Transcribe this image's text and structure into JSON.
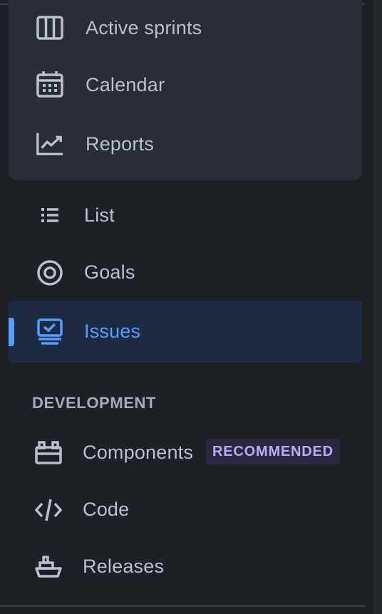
{
  "nav": {
    "planning_items": [
      {
        "label": "Active sprints",
        "icon": "board-columns-icon"
      },
      {
        "label": "Calendar",
        "icon": "calendar-icon"
      },
      {
        "label": "Reports",
        "icon": "chart-line-icon"
      }
    ],
    "items": [
      {
        "label": "List",
        "icon": "list-icon"
      },
      {
        "label": "Goals",
        "icon": "target-icon"
      },
      {
        "label": "Issues",
        "icon": "issues-icon",
        "selected": true
      }
    ]
  },
  "development": {
    "heading": "DEVELOPMENT",
    "items": [
      {
        "label": "Components",
        "icon": "components-icon",
        "badge": "RECOMMENDED"
      },
      {
        "label": "Code",
        "icon": "code-icon"
      },
      {
        "label": "Releases",
        "icon": "ship-icon"
      }
    ]
  },
  "colors": {
    "background": "#1d2125",
    "text": "#b6c2cf",
    "accent": "#579dff",
    "selected_bg": "#1c2b41",
    "badge_bg": "#2b273f",
    "badge_text": "#b8acf6"
  }
}
